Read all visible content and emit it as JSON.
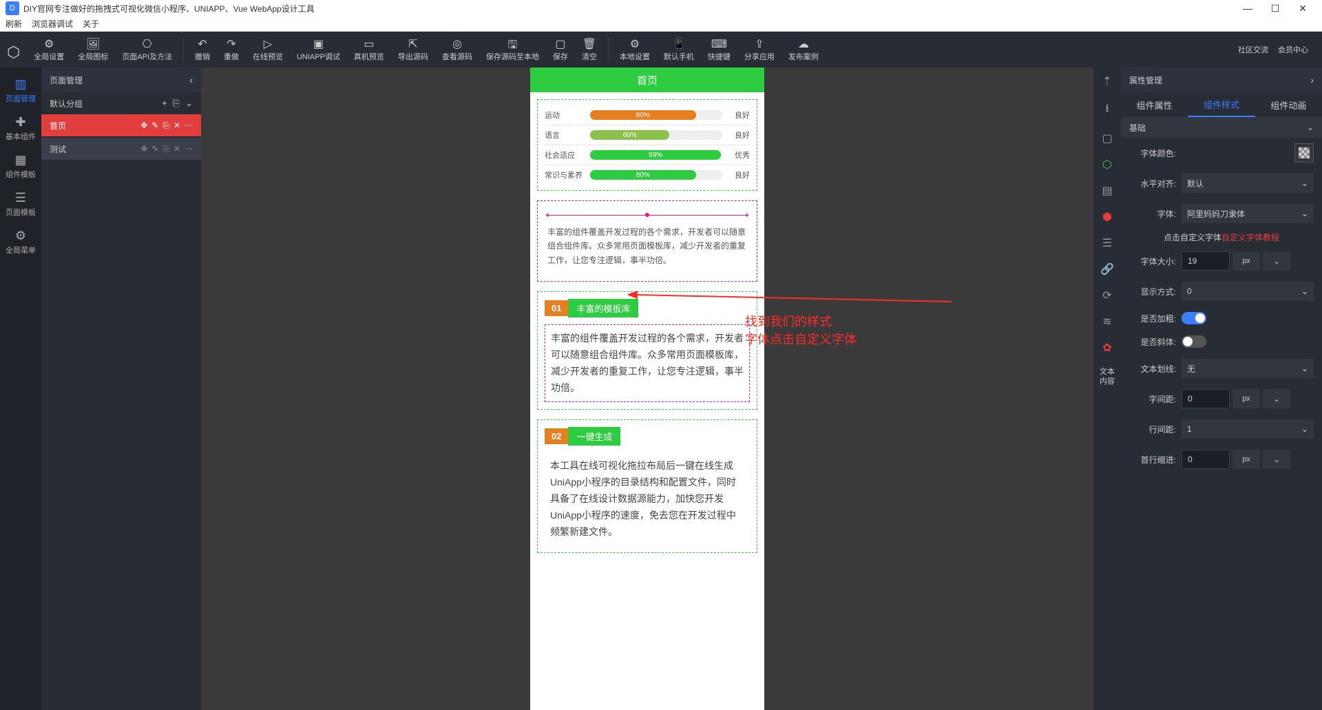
{
  "window": {
    "title": "DIY官网专注做好的拖拽式可视化微信小程序、UNIAPP、Vue WebApp设计工具"
  },
  "menubar": {
    "items": [
      "刷新",
      "浏览器调试",
      "关于"
    ]
  },
  "toolbar": {
    "globalSettings": "全局设置",
    "globalIcons": "全局图标",
    "pageApi": "页面API及方法",
    "undo": "撤销",
    "redo": "重做",
    "onlinePreview": "在线预览",
    "uniappDebug": "UNIAPP调试",
    "realPreview": "真机预览",
    "exportSrc": "导出源码",
    "viewSrc": "查看源码",
    "saveLocal": "保存源码至本地",
    "save": "保存",
    "clear": "清空",
    "localSettings": "本地设置",
    "defaultPhone": "默认手机",
    "hotkey": "快捷键",
    "shareApp": "分享应用",
    "publishCase": "发布案例",
    "community": "社区交流",
    "memberCenter": "会员中心"
  },
  "leftRail": {
    "page": "页面管理",
    "basic": "基本组件",
    "compTpl": "组件模板",
    "pageTpl": "页面模板",
    "globalMenu": "全局菜单"
  },
  "pagePanel": {
    "title": "页面管理",
    "group": "默认分组",
    "pages": [
      "首页",
      "测试"
    ]
  },
  "preview": {
    "title": "首页",
    "progress": [
      {
        "label": "运动",
        "pct": "80%",
        "status": "良好",
        "color": "#e67e22"
      },
      {
        "label": "语言",
        "pct": "60%",
        "status": "良好",
        "color": "#8bc34a"
      },
      {
        "label": "社会适应",
        "pct": "99%",
        "status": "优秀",
        "color": "#2ecc40"
      },
      {
        "label": "常识与素养",
        "pct": "80%",
        "status": "良好",
        "color": "#2ecc40"
      }
    ],
    "quote": "丰富的组件覆盖开发过程的各个需求，开发者可以随意组合组件库。众多常用页面模板库，减少开发者的重复工作，让您专注逻辑，事半功倍。",
    "sections": [
      {
        "num": "01",
        "title": "丰富的模板库",
        "text": "丰富的组件覆盖开发过程的各个需求，开发者可以随意组合组件库。众多常用页面模板库，减少开发者的重复工作，让您专注逻辑，事半功倍。",
        "boxed": true
      },
      {
        "num": "02",
        "title": "一键生成",
        "text": "本工具在线可视化拖拉布局后一键在线生成UniApp小程序的目录结构和配置文件，同时具备了在线设计数据源能力，加快您开发UniApp小程序的速度，免去您在开发过程中频繁新建文件。",
        "boxed": false
      }
    ]
  },
  "propTabs": {
    "attr": "组件属性",
    "style": "组件样式",
    "anim": "组件动画"
  },
  "propPanel": {
    "title": "属性管理",
    "section": "基础",
    "fontColor": "字体颜色:",
    "hAlign": "水平对齐:",
    "hAlignVal": "默认",
    "font": "字体:",
    "fontVal": "阿里妈妈刀隶体",
    "customFontLink": "点击自定义字体",
    "customFontTut": "自定义字体教程",
    "fontSize": "字体大小:",
    "fontSizeVal": "19",
    "fontSizeUnit": "px",
    "display": "显示方式:",
    "displayVal": "0",
    "bold": "是否加粗:",
    "italic": "是否斜体:",
    "decoration": "文本划线:",
    "decorationVal": "无",
    "letterSpacing": "字间距:",
    "letterSpacingVal": "0",
    "letterSpacingUnit": "px",
    "lineHeight": "行间距:",
    "lineHeightVal": "1",
    "textIndent": "首行缩进:",
    "textIndentVal": "0",
    "textIndentUnit": "px",
    "textContent": "文本\n内容"
  },
  "annotation": {
    "line1": "找到我们的样式",
    "line2": "字体点击自定义字体"
  }
}
